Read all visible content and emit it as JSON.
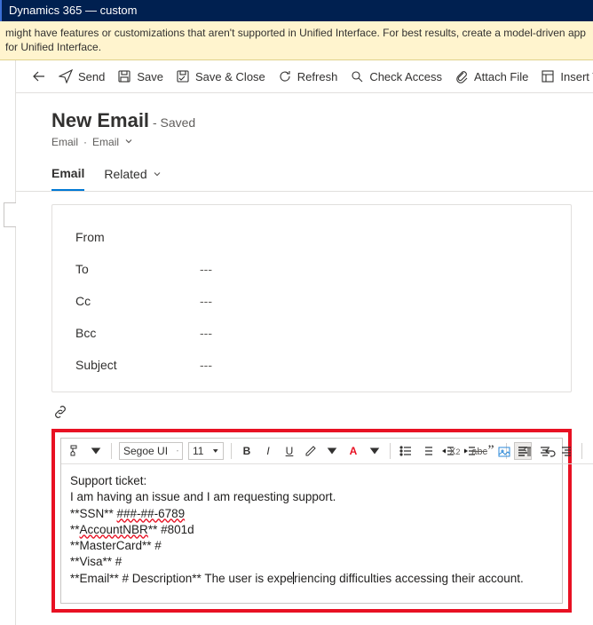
{
  "titlebar": {
    "text": "Dynamics 365 — custom"
  },
  "warning": {
    "text": "might have features or customizations that aren't supported in Unified Interface. For best results, create a model-driven app for Unified Interface."
  },
  "commands": {
    "send": "Send",
    "save": "Save",
    "save_close": "Save & Close",
    "refresh": "Refresh",
    "check_access": "Check Access",
    "attach_file": "Attach File",
    "insert_template": "Insert Templat"
  },
  "header": {
    "title": "New Email",
    "status": "- Saved",
    "breadcrumb_a": "Email",
    "breadcrumb_sep": "·",
    "breadcrumb_b": "Email"
  },
  "tabs": {
    "email": "Email",
    "related": "Related"
  },
  "fields": {
    "from_label": "From",
    "from_value": "",
    "to_label": "To",
    "to_value": "---",
    "cc_label": "Cc",
    "cc_value": "---",
    "bcc_label": "Bcc",
    "bcc_value": "---",
    "subject_label": "Subject",
    "subject_value": "---"
  },
  "editor": {
    "font_name": "Segoe UI",
    "font_size": "11",
    "extra_x2": "X",
    "extra_sub": "2",
    "extra_abc": "abc",
    "body_lines": {
      "l1": "Support ticket:",
      "l2": "I am having an issue and I am requesting support.",
      "l3a": "**SSN** ",
      "l3b": "###-##-6789",
      "l4a": "**",
      "l4b": "AccountNBR",
      "l4c": "**  #801d",
      "l5": "**MasterCard** #",
      "l6": "**Visa** #",
      "l7a": "**Email** # Description** The user is expe",
      "l7b": "riencing difficulties accessing their account."
    }
  }
}
